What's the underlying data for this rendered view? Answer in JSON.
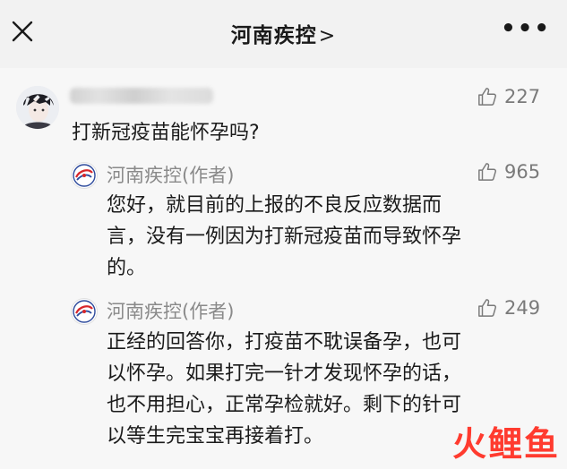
{
  "header": {
    "title": "河南疾控",
    "chevron": ">",
    "close_icon": "close-icon",
    "more_icon": "more-horizontal-icon",
    "more_label": "•••"
  },
  "comment": {
    "avatar_icon": "user-avatar",
    "username_blurred": true,
    "likes": "227",
    "text": "打新冠疫苗能怀孕吗?"
  },
  "replies": [
    {
      "author": "河南疾控(作者)",
      "likes": "965",
      "lines": [
        "您好，就目前的上报的不良反应数据而",
        "言，没有一例因为打新冠疫苗而导致怀孕",
        "的。"
      ]
    },
    {
      "author": "河南疾控(作者)",
      "likes": "249",
      "lines": [
        "正经的回答你，打疫苗不耽误备孕，也可",
        "以怀孕。如果打完一针才发现怀孕的话，",
        "也不用担心，正常孕检就好。剩下的针可",
        "以等生完宝宝再接着打。"
      ]
    }
  ],
  "watermark": "火鲤鱼",
  "colors": {
    "background": "#f2f2f2",
    "secondary_text": "#8a8a8a",
    "watermark": "#ff3b2f",
    "logo_red": "#d7262a",
    "logo_blue": "#2d4a9c"
  }
}
